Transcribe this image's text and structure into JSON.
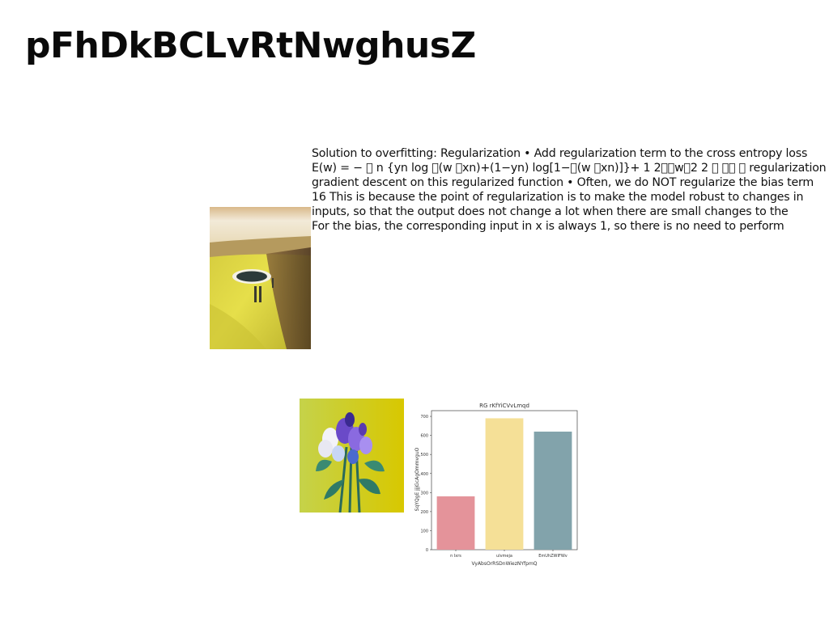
{
  "title": "pFhDkBCLvRtNwghusZ",
  "slide_text": [
    "Solution to overfitting: Regularization • Add regularization term to the cross entropy loss",
    "E(w) = − \u0000 n {yn log \u0000(w \u0000xn)+(1−yn) log[1−\u0000(w \u0000xn)]}+ 1 2\u0000\u0000w\u00002 2 \u0000 \u0000\u0000 \u0000 regularization •",
    "gradient descent on this regularized function • Often, we do NOT regularize the bias term",
    "16 This is because the point of regularization is to make the model robust to changes in",
    "inputs, so that the output does not change a lot when there are small changes to the",
    "For the bias, the corresponding input in x is always 1, so there is no need to perform"
  ],
  "images": {
    "beach_photo": "beach-island-icon",
    "flowers_photo": "flower-bouquet-icon"
  },
  "chart_data": {
    "type": "bar",
    "title": "RG rKfYiCVvLmqd",
    "xlabel": "VyAbsOrRSDnWiezNYfpmQ",
    "ylabel": "SqYQgE jjjGcAgOmmvguO",
    "categories": [
      "n Ixrs",
      "ulvmeja",
      "EmUhZWIFWv"
    ],
    "values": [
      280,
      690,
      620
    ],
    "colors": [
      "#e4939a",
      "#f5e097",
      "#82a3ab"
    ],
    "ylim": [
      0,
      730
    ],
    "yticks": [
      0,
      100,
      200,
      300,
      400,
      500,
      600,
      700
    ],
    "grid": false,
    "legend": "none"
  }
}
